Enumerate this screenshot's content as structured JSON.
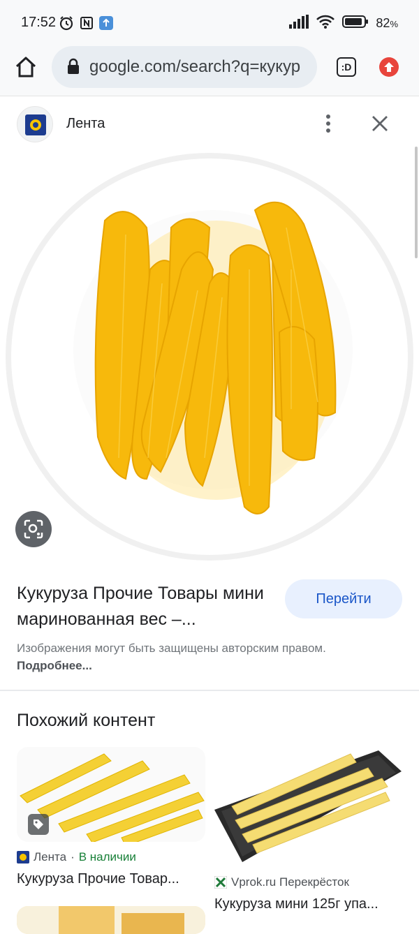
{
  "status_bar": {
    "time": "17:52",
    "battery": "82",
    "battery_unit": "%"
  },
  "toolbar": {
    "url": "google.com/search?q=кукурузa мини",
    "url_display": "google.com/search?q=кукур",
    "tab_label": ":D"
  },
  "source": {
    "name": "Лента"
  },
  "result": {
    "title": "Кукуруза Прочие Товары мини маринованная вес –...",
    "go_button": "Перейти",
    "copyright_text": "Изображения могут быть защищены авторским правом.",
    "copyright_link": "Подробнее..."
  },
  "similar": {
    "heading": "Похожий контент",
    "cards": [
      {
        "source": "Лента",
        "separator": "·",
        "availability": "В наличии",
        "title": "Кукуруза Прочие Товар..."
      },
      {
        "source": "Vprok.ru Перекрёсток",
        "title": "Кукуруза мини 125г упа..."
      }
    ]
  },
  "colors": {
    "accent_blue": "#1a56c8",
    "in_stock_green": "#188038",
    "upload_red": "#e8453c"
  }
}
